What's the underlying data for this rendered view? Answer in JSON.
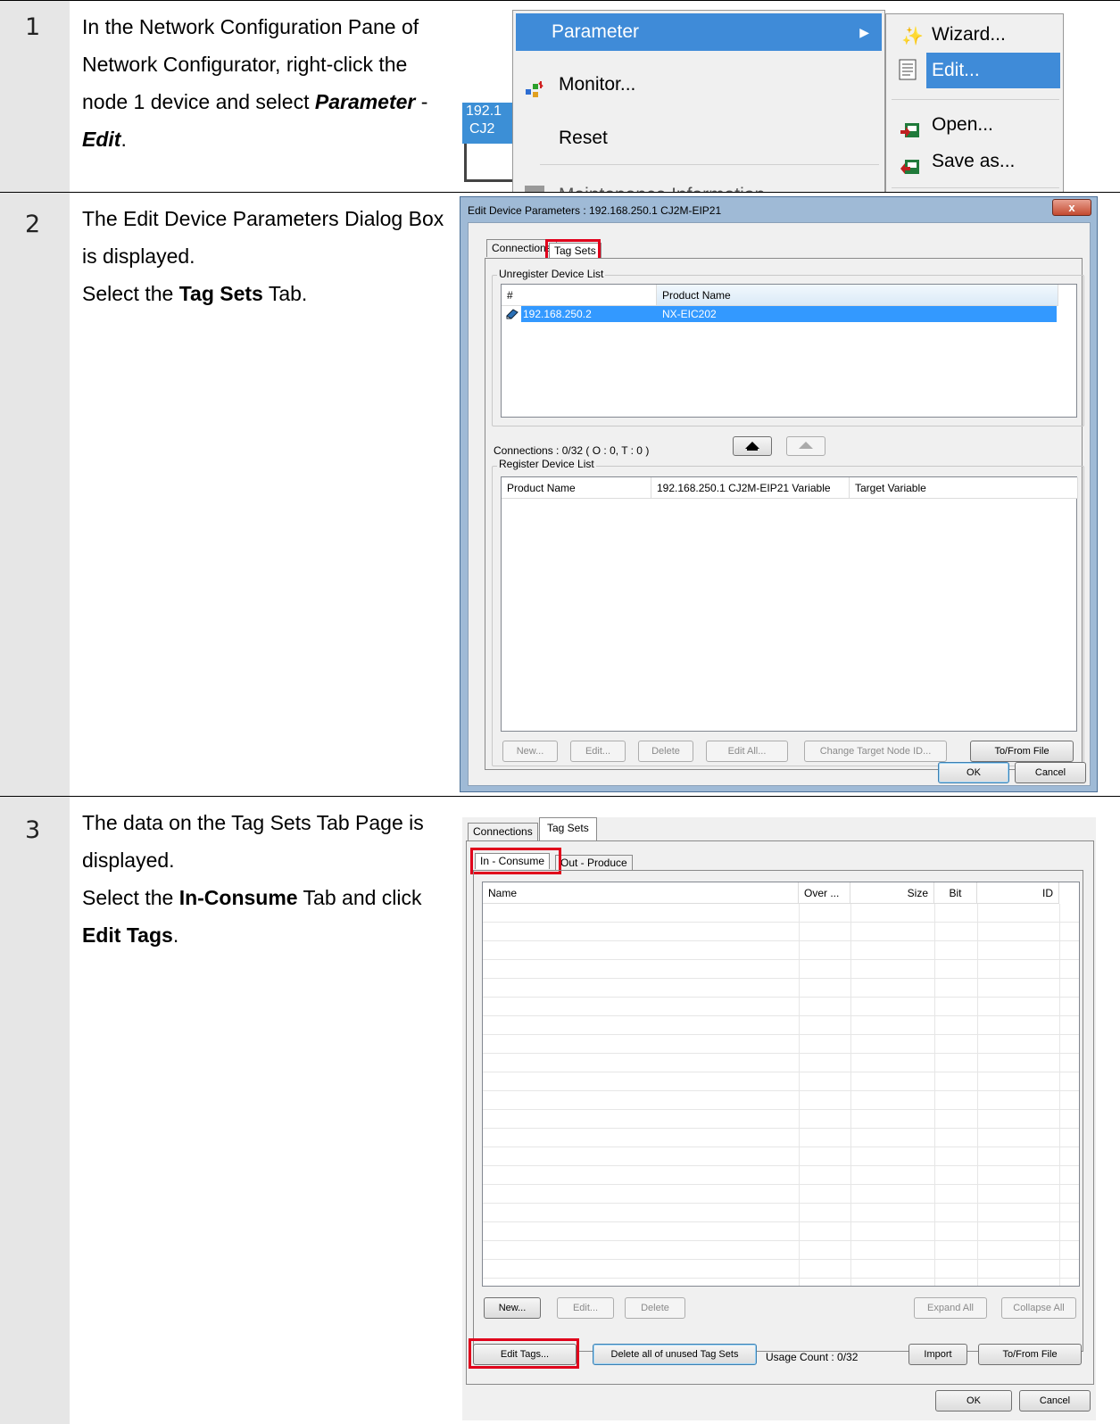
{
  "steps": [
    {
      "number": "1",
      "text_parts": [
        "In the Network Configuration Pane of Network Configurator, right-click the node 1 device and select ",
        "Parameter",
        " - ",
        "Edit",
        "."
      ]
    },
    {
      "number": "2",
      "text_parts": [
        "The Edit Device Parameters Dialog Box is displayed.",
        "Select the ",
        "Tag Sets",
        " Tab."
      ]
    },
    {
      "number": "3",
      "text_parts": [
        "The data on the Tag Sets Tab Page is displayed.",
        "Select the ",
        "In-Consume",
        " Tab and click ",
        "Edit Tags",
        "."
      ]
    }
  ],
  "menu1": {
    "parameter": "Parameter",
    "monitor": "Monitor...",
    "reset": "Reset",
    "maintenance": "Maintenance Information",
    "node_ip": "192.1",
    "node_model": "CJ2",
    "submenu": [
      "Wizard...",
      "Edit...",
      "Open...",
      "Save as..."
    ]
  },
  "dialog2": {
    "title": "Edit Device Parameters : 192.168.250.1 CJ2M-EIP21",
    "close": "x",
    "tabs": [
      "Connections",
      "Tag Sets"
    ],
    "unregister_label": "Unregister Device List",
    "unregister_headers": [
      "#",
      "Product Name"
    ],
    "unregister_row": {
      "ip": "192.168.250.2",
      "product": "NX-EIC202"
    },
    "connections_text": "Connections :  0/32 ( O : 0, T : 0 )",
    "register_label": "Register Device List",
    "register_headers": [
      "Product Name",
      "192.168.250.1 CJ2M-EIP21 Variable",
      "Target Variable"
    ],
    "buttons": [
      "New...",
      "Edit...",
      "Delete",
      "Edit All...",
      "Change Target Node ID...",
      "To/From File"
    ],
    "ok": "OK",
    "cancel": "Cancel"
  },
  "dialog3": {
    "tabs": [
      "Connections",
      "Tag Sets"
    ],
    "subtabs": [
      "In - Consume",
      "Out - Produce"
    ],
    "headers": [
      "Name",
      "Over ...",
      "Size",
      "Bit",
      "ID"
    ],
    "list_buttons": [
      "New...",
      "Edit...",
      "Delete",
      "Expand All",
      "Collapse All"
    ],
    "edit_tags": "Edit Tags...",
    "delete_unused": "Delete all of unused Tag Sets",
    "usage_count": "Usage Count :  0/32",
    "import": "Import",
    "to_from_file": "To/From File",
    "ok": "OK",
    "cancel": "Cancel"
  }
}
